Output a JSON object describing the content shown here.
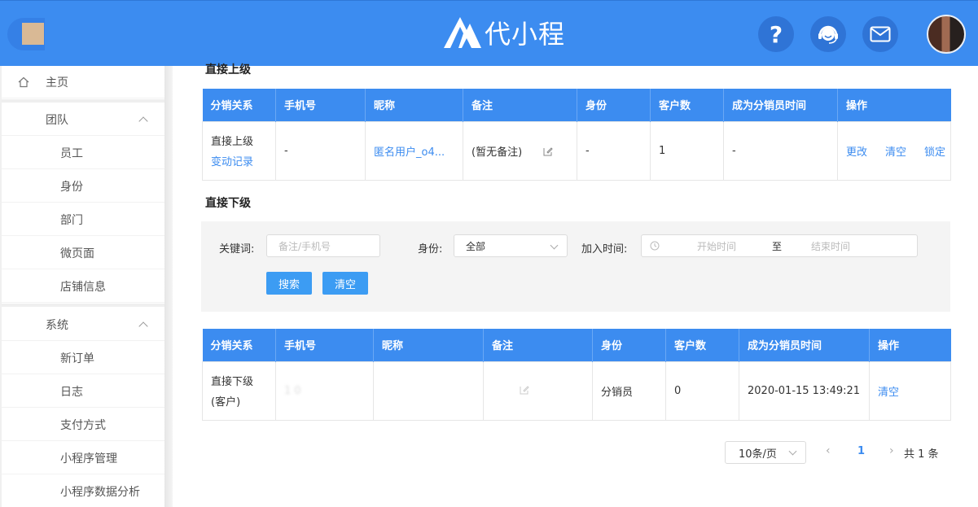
{
  "header": {
    "brand": "代小程",
    "icons": [
      "help-icon",
      "support-headset-icon",
      "mail-icon"
    ]
  },
  "sidebar": {
    "home": "主页",
    "groups": [
      {
        "label": "团队",
        "items": [
          "员工",
          "身份",
          "部门",
          "微页面",
          "店铺信息"
        ]
      },
      {
        "label": "系统",
        "items": [
          "新订单",
          "日志",
          "支付方式",
          "小程序管理",
          "小程序数据分析"
        ]
      }
    ]
  },
  "upline": {
    "title": "直接上级",
    "columns": [
      "分销关系",
      "手机号",
      "昵称",
      "备注",
      "身份",
      "客户数",
      "成为分销员时间",
      "操作"
    ],
    "row": {
      "relation": "直接上级",
      "change_log": "变动记录",
      "phone": "-",
      "nickname": "匿名用户_o4...",
      "remark": "(暂无备注)",
      "identity": "-",
      "customers": "1",
      "join_time": "-",
      "actions": [
        "更改",
        "清空",
        "锁定"
      ]
    }
  },
  "downline": {
    "title": "直接下级",
    "filter": {
      "keyword_label": "关键词:",
      "keyword_placeholder": "备注/手机号",
      "identity_label": "身份:",
      "identity_value": "全部",
      "time_label": "加入时间:",
      "start_placeholder": "开始时间",
      "range_sep": "至",
      "end_placeholder": "结束时间",
      "search_btn": "搜索",
      "clear_btn": "清空"
    },
    "columns": [
      "分销关系",
      "手机号",
      "昵称",
      "备注",
      "身份",
      "客户数",
      "成为分销员时间",
      "操作"
    ],
    "row": {
      "relation_line1": "直接下级",
      "relation_line2": "(客户)",
      "phone": "1          0",
      "identity": "分销员",
      "customers": "0",
      "join_time": "2020-01-15 13:49:21",
      "action": "清空"
    }
  },
  "pagination": {
    "page_size": "10条/页",
    "current": "1",
    "total": "共 1 条"
  },
  "colors": {
    "primary": "#3c8cf0",
    "header_bg": "#3c8cf0",
    "button": "#3c9cf3"
  }
}
